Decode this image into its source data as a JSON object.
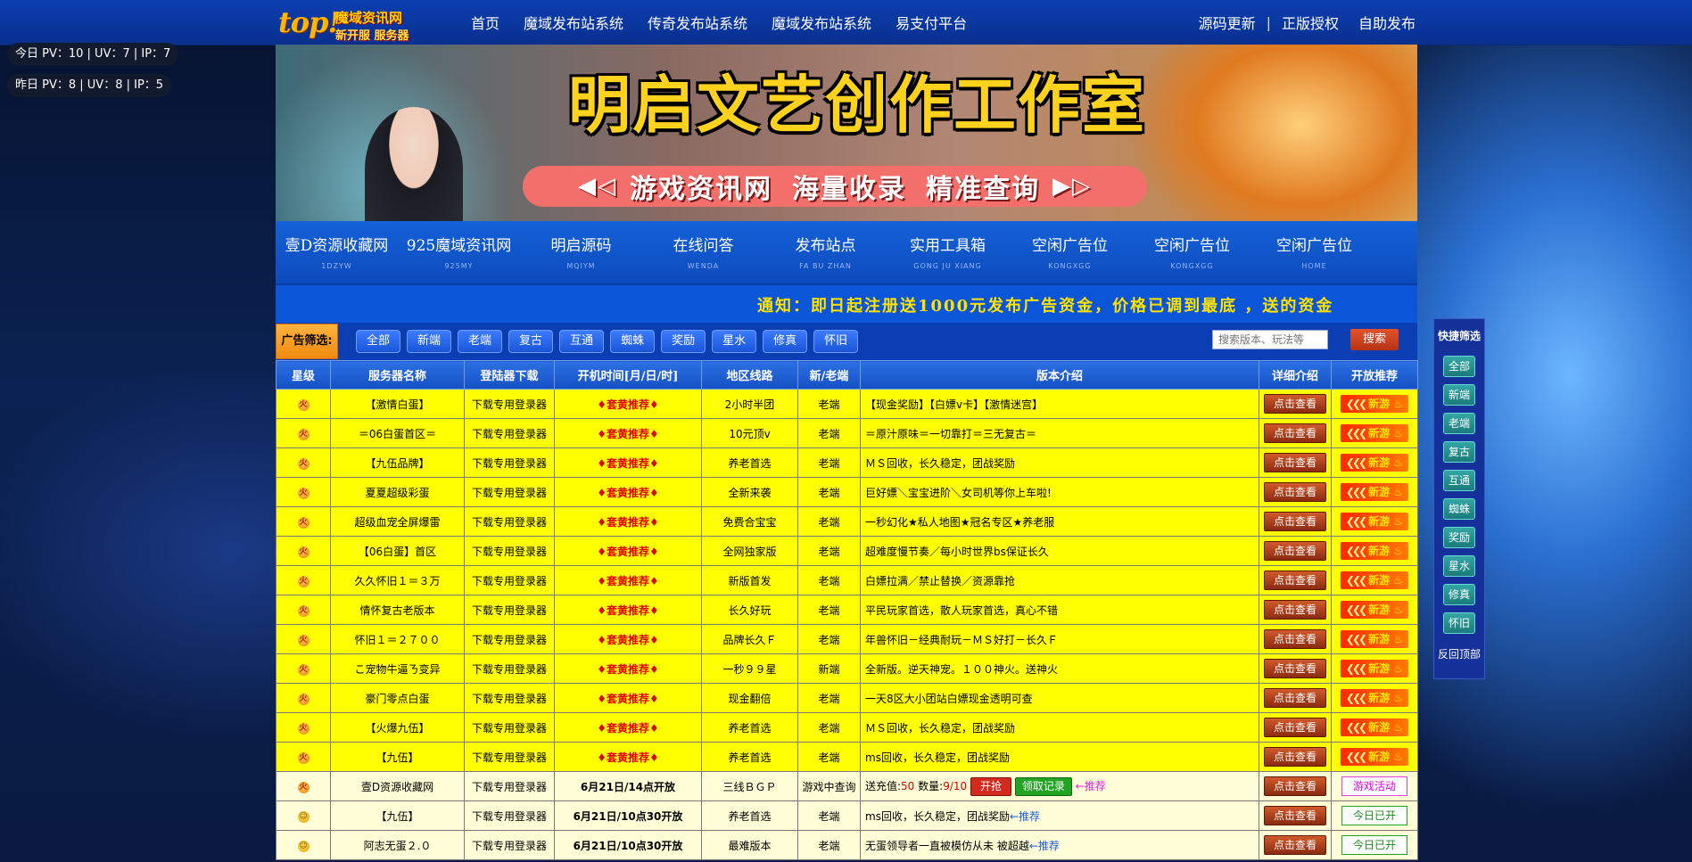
{
  "logo": {
    "line1": "top!",
    "line2": "魔域资讯网",
    "line3": "新开服 服务器"
  },
  "nav_left": [
    "首页",
    "魔域发布站系统",
    "传奇发布站系统",
    "魔域发布站系统",
    "易支付平台"
  ],
  "nav_right": [
    "源码更新",
    "正版授权",
    "自助发布"
  ],
  "nav_right_sep": "|",
  "stats": {
    "today": "今日 PV：10 | UV：7 | IP：7",
    "yesterday": "昨日 PV：8 | UV：8 | IP：5"
  },
  "banner": {
    "title": "明启文艺创作工作室",
    "slogan_parts": [
      "游戏资讯网",
      "海量收录",
      "精准查询"
    ],
    "arrow_left": "◀◁",
    "arrow_right": "▶▷"
  },
  "links": [
    {
      "title": "壹D资源收藏网",
      "sub": "1DZYW"
    },
    {
      "title": "925魔域资讯网",
      "sub": "925MY"
    },
    {
      "title": "明启源码",
      "sub": "MQIYM"
    },
    {
      "title": "在线问答",
      "sub": "WENDA"
    },
    {
      "title": "发布站点",
      "sub": "FA BU ZHAN"
    },
    {
      "title": "实用工具箱",
      "sub": "GONG JU XIANG"
    },
    {
      "title": "空闲广告位",
      "sub": "KONGXGG"
    },
    {
      "title": "空闲广告位",
      "sub": "KONGXGG"
    },
    {
      "title": "空闲广告位",
      "sub": "HOME"
    }
  ],
  "notice": "通知：即日起注册送1000元发布广告资金，价格已调到最底 ，送的资金",
  "filter": {
    "title": "广告筛选:",
    "chips": [
      "全部",
      "新端",
      "老端",
      "复古",
      "互通",
      "蜘蛛",
      "奖励",
      "星水",
      "修真",
      "怀旧"
    ],
    "search_placeholder": "搜索版本、玩法等",
    "search_button": "搜索"
  },
  "table": {
    "headers": [
      "星级",
      "服务器名称",
      "登陆器下载",
      "开机时间[月/日/时]",
      "地区线路",
      "新/老端",
      "版本介绍",
      "详细介绍",
      "开放推荐"
    ],
    "detail_label": "点击查看",
    "newgame_label": "新游",
    "download_label": "下载专用登录器",
    "rec_label": "套黄推荐",
    "hot_rows": [
      {
        "name": "【激情白蛋】",
        "line": "2小时半团",
        "type": "老端",
        "intro": "【现金奖励】【白嫖v卡】【激情迷宫】"
      },
      {
        "name": "＝06白蛋首区＝",
        "line": "10元顶v",
        "type": "老端",
        "intro": "＝原汁原味＝一切靠打＝三无复古＝"
      },
      {
        "name": "【九伍品牌】",
        "line": "养老首选",
        "type": "老端",
        "intro": "ＭＳ回收，长久稳定，团战奖励"
      },
      {
        "name": "夏夏超级彩蛋",
        "line": "全新来袭",
        "type": "老端",
        "intro": "巨好嫖＼宝宝进阶＼女司机等你上车啦!"
      },
      {
        "name": "超级血宠全屏爆雷",
        "line": "免费合宝宝",
        "type": "老端",
        "intro": "一秒幻化★私人地图★冠名专区★养老服"
      },
      {
        "name": "【06白蛋】首区",
        "line": "全网独家版",
        "type": "老端",
        "intro": "超难度慢节奏／每小时世界bs保证长久"
      },
      {
        "name": "久久怀旧１＝３万",
        "line": "新版首发",
        "type": "老端",
        "intro": "白嫖拉满／禁止替换／资源靠抢"
      },
      {
        "name": "情怀复古老版本",
        "line": "长久好玩",
        "type": "老端",
        "intro": "平民玩家首选，散人玩家首选，真心不错"
      },
      {
        "name": "怀旧１＝２７００",
        "line": "品牌长久Ｆ",
        "type": "老端",
        "intro": "年兽怀旧－经典耐玩－ＭＳ好打－长久Ｆ"
      },
      {
        "name": "こ宠物牛逼ㄋ变异",
        "line": "一秒９９星",
        "type": "新端",
        "intro": "全新版。逆天神宠。１００神火。送神火"
      },
      {
        "name": "豪门零点白蛋",
        "line": "现金翻倍",
        "type": "老端",
        "intro": "一天8区大小团站白嫖现金透明可查"
      },
      {
        "name": "【火爆九伍】",
        "line": "养老首选",
        "type": "老端",
        "intro": "ＭＳ回收，长久稳定，团战奖励"
      },
      {
        "name": "【九伍】",
        "line": "养老首选",
        "type": "老端",
        "intro": "ms回收，长久稳定，团战奖励"
      }
    ],
    "special_row": {
      "name": "壹D资源收藏网",
      "time": "6月21日/14点开放",
      "line": "三线ＢＧＰ",
      "type": "游戏中查询",
      "intro_prefix": "送充值:",
      "intro_val1": "50",
      "intro_mid": " 数量:",
      "intro_val2": "9/10",
      "start_label": "开抢",
      "record_label": "领取记录",
      "recommend": "←推荐",
      "tag": "游戏活动"
    },
    "norm_rows": [
      {
        "name": "【九伍】",
        "time": "6月21日/10点30开放",
        "line": "养老首选",
        "type": "老端",
        "intro": "ms回收，长久稳定，团战奖励",
        "rec": "←推荐",
        "tag": "今日已开"
      },
      {
        "name": "阿志无蛋２.０",
        "time": "6月21日/10点30开放",
        "line": "最难版本",
        "type": "老端",
        "intro": "无蛋领导者一直被模仿从未  被超越",
        "rec": "←推荐",
        "tag": "今日已开"
      }
    ]
  },
  "quick_filter": {
    "title": "快捷筛选",
    "items": [
      "全部",
      "新端",
      "老端",
      "复古",
      "互通",
      "蜘蛛",
      "奖励",
      "星水",
      "修真",
      "怀旧"
    ],
    "back": "反回顶部"
  }
}
